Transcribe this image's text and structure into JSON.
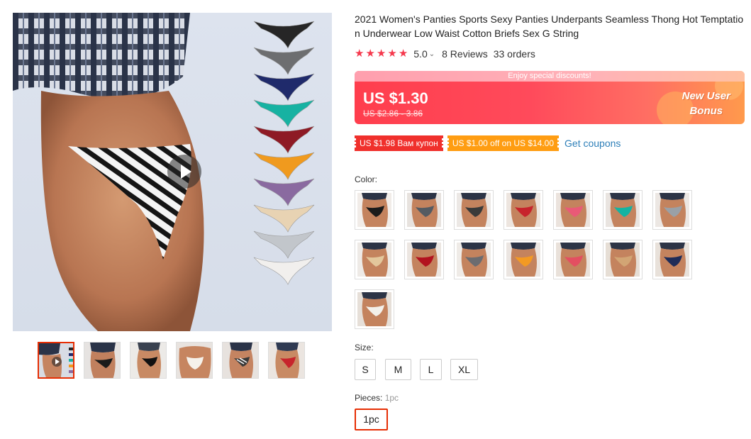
{
  "product": {
    "title": "2021 Women's Panties Sports Sexy Panties Underpants Seamless Thong Hot Temptation Underwear Low Waist Cotton Briefs Sex G String"
  },
  "rating": {
    "stars_icon": "star-icon",
    "value": "5.0",
    "reviews": "8 Reviews",
    "orders": "33 orders",
    "star_color": "#f5394d"
  },
  "price": {
    "banner_notice": "Enjoy special discounts!",
    "current": "US $1.30",
    "original": "US $2.86 - 3.86",
    "badge": "New User Bonus",
    "colors": {
      "start": "#ff3e4d",
      "end": "#ff9a4c"
    }
  },
  "coupons": {
    "items": [
      {
        "label": "US $1.98 Вам купон",
        "color": "#f0302c"
      },
      {
        "label": "US $1.00 off on US $14.00",
        "color": "#ff9d12"
      }
    ],
    "link": "Get coupons"
  },
  "color_section": {
    "label": "Color:",
    "swatches": [
      {
        "name": "black",
        "fabric": "#1b1b1b",
        "bg": "#f1ece8"
      },
      {
        "name": "gray",
        "fabric": "#555b62",
        "bg": "#e7e2de"
      },
      {
        "name": "zebra",
        "fabric": "#3a3a3a",
        "bg": "#ece8e5"
      },
      {
        "name": "red",
        "fabric": "#c7242c",
        "bg": "#ede5df"
      },
      {
        "name": "pink",
        "fabric": "#e95a77",
        "bg": "#ebe3dd"
      },
      {
        "name": "teal",
        "fabric": "#15b3a1",
        "bg": "#e9e4e0"
      },
      {
        "name": "gray-light",
        "fabric": "#9aa0a6",
        "bg": "#ece7e3"
      },
      {
        "name": "beige",
        "fabric": "#e3c79c",
        "bg": "#eeeae6"
      },
      {
        "name": "wine",
        "fabric": "#b2131f",
        "bg": "#ece6e1"
      },
      {
        "name": "gray-dark",
        "fabric": "#6c6c70",
        "bg": "#efebe7"
      },
      {
        "name": "orange",
        "fabric": "#f39a23",
        "bg": "#ebe5e1"
      },
      {
        "name": "rose",
        "fabric": "#e34f61",
        "bg": "#e9e1da"
      },
      {
        "name": "gold",
        "fabric": "#d2a574",
        "bg": "#e6ded5"
      },
      {
        "name": "navy",
        "fabric": "#1f2c58",
        "bg": "#e8e1da"
      },
      {
        "name": "white",
        "fabric": "#f3f0ea",
        "bg": "#e6dfd8"
      }
    ]
  },
  "size_section": {
    "label": "Size:",
    "options": [
      "S",
      "M",
      "L",
      "XL"
    ]
  },
  "pieces_section": {
    "label": "Pieces:",
    "selected_value": "1pc",
    "options": [
      "1pc"
    ]
  },
  "gallery": {
    "main_colors": [
      "#d8dce4",
      "#262626",
      "#6d6e70",
      "#1f2a6b",
      "#17b2a2",
      "#8e1a25",
      "#f09a1e",
      "#8a6aa0",
      "#e8d3b3",
      "#c2c6cb",
      "#f1efed"
    ],
    "thumbnails": [
      "video-thumb",
      "black",
      "black-back",
      "white",
      "zebra",
      "red"
    ],
    "play_icon": "play-icon"
  }
}
